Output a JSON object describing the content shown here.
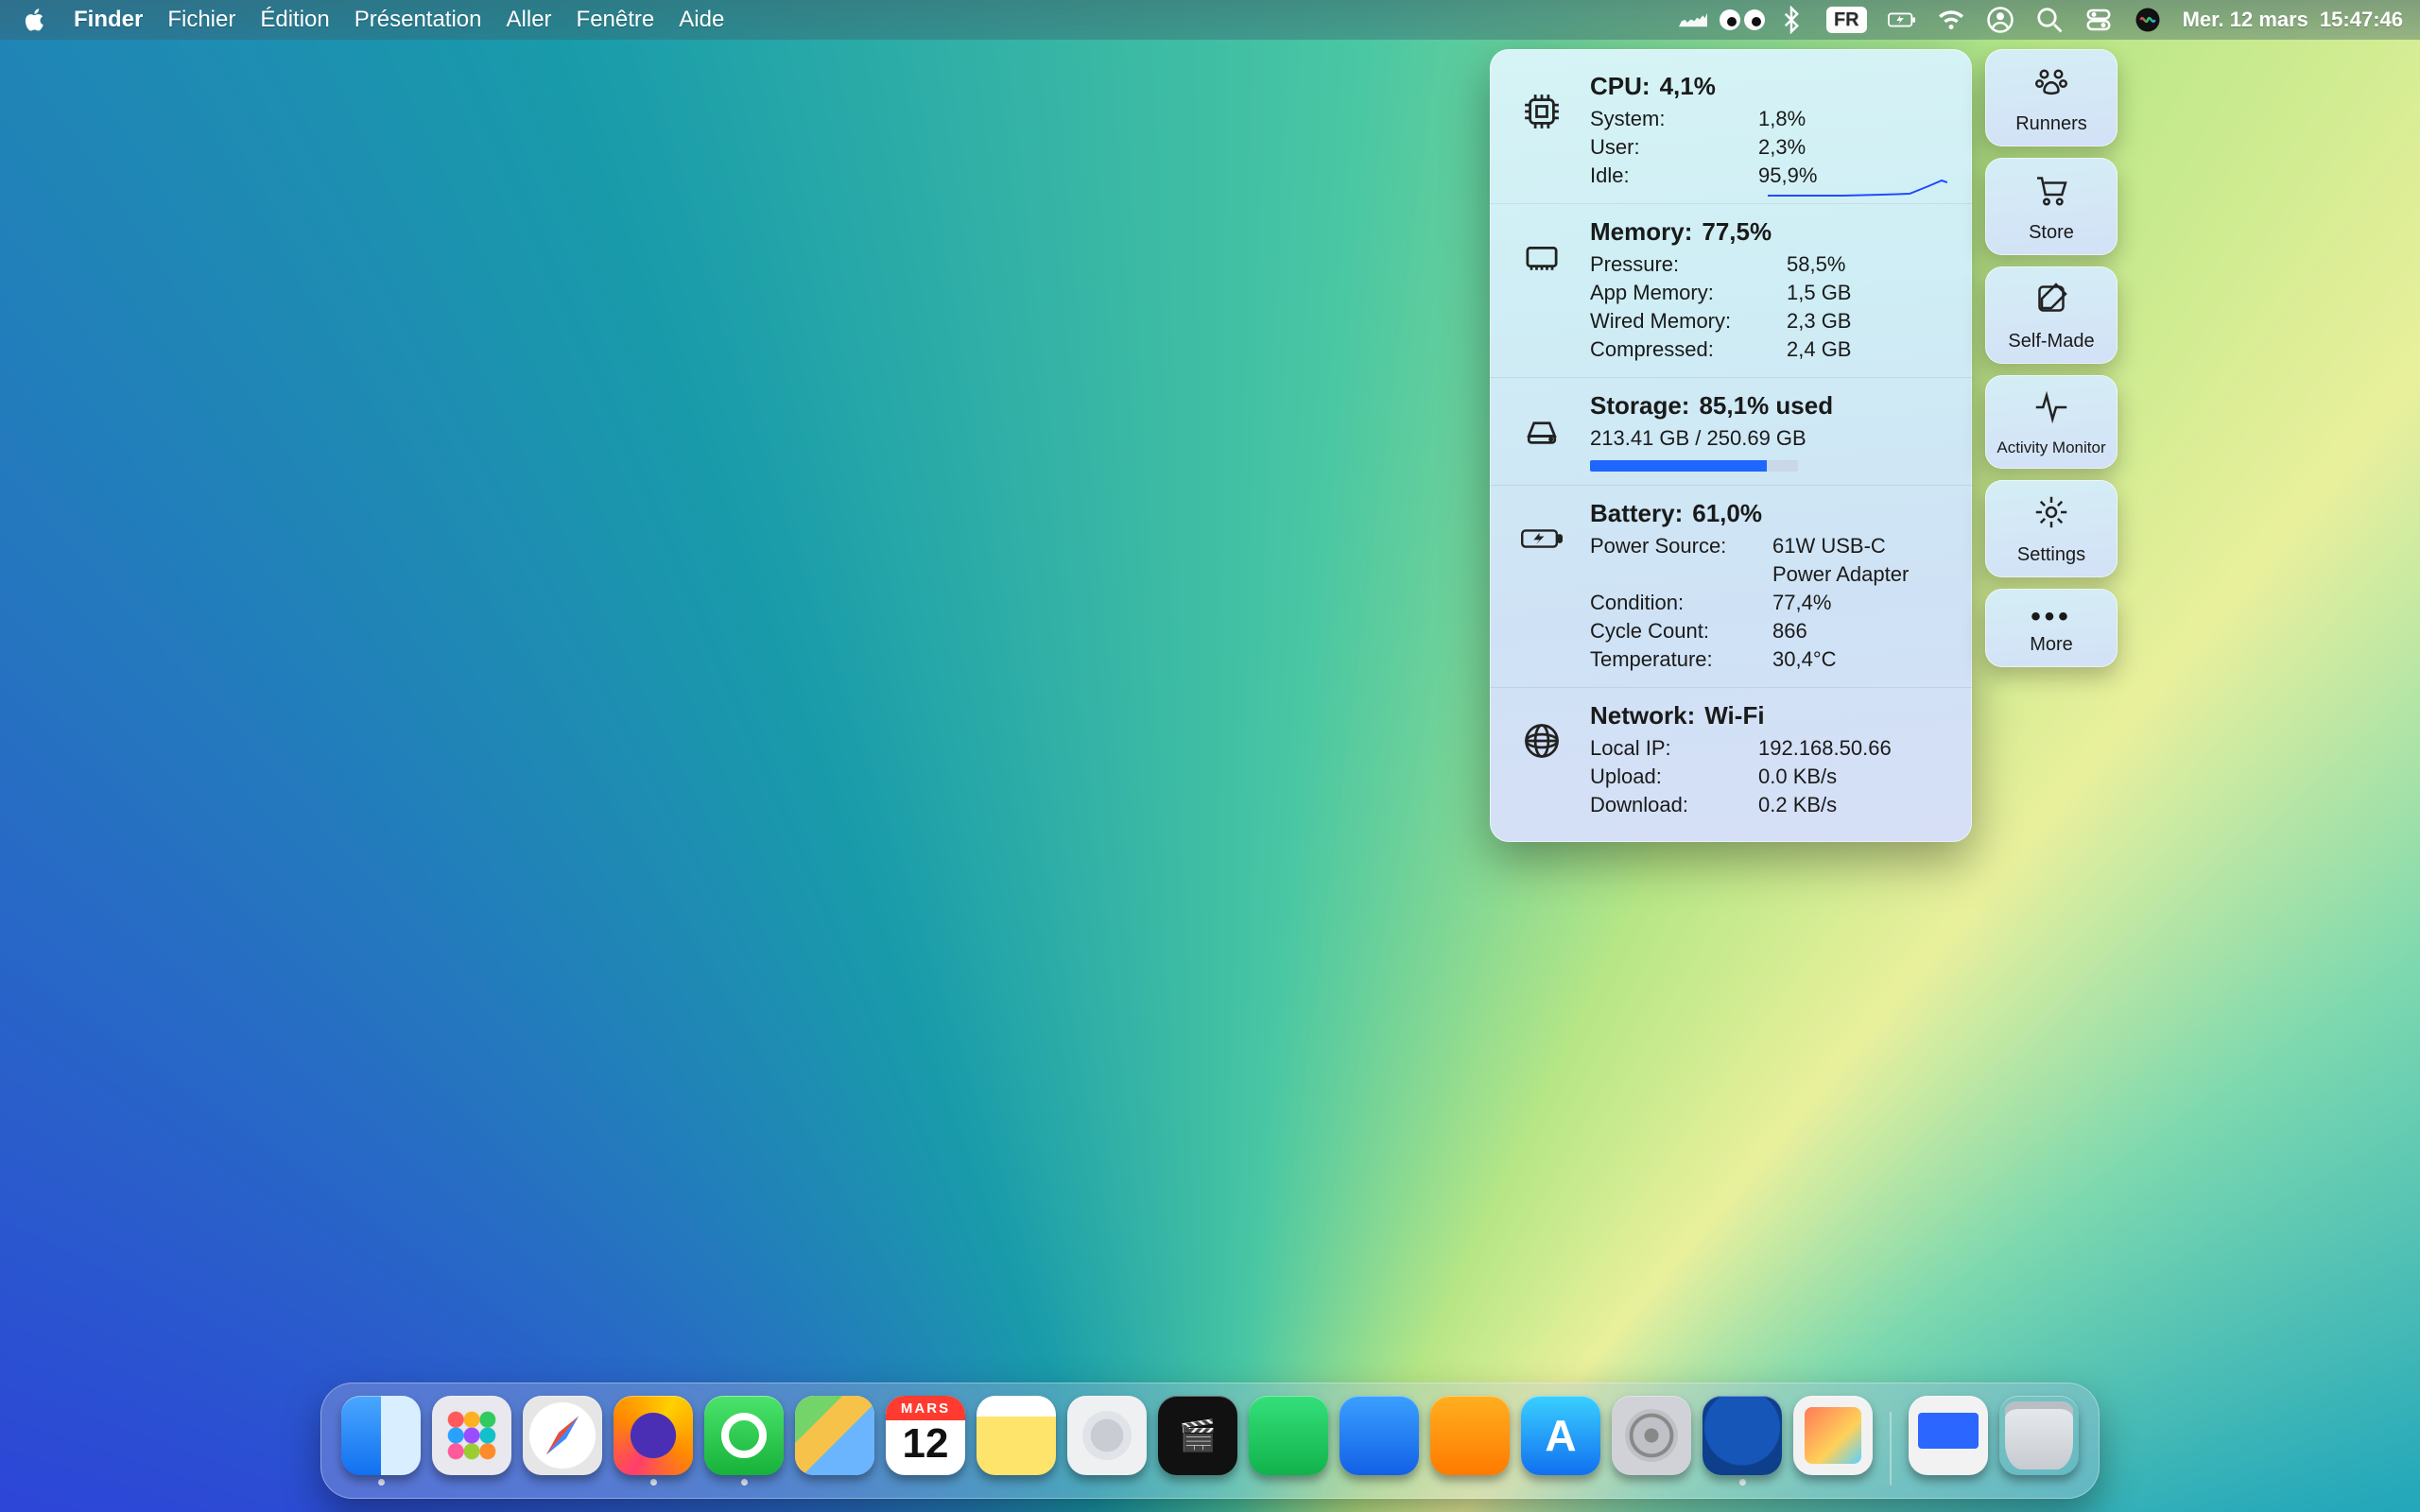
{
  "menubar": {
    "app_name": "Finder",
    "menus": [
      "Fichier",
      "Édition",
      "Présentation",
      "Aller",
      "Fenêtre",
      "Aide"
    ],
    "input_badge": "FR",
    "date": "Mer. 12 mars",
    "time": "15:47:46"
  },
  "runcat_panel": {
    "cpu": {
      "title_label": "CPU:",
      "title_value": "4,1%",
      "rows": [
        {
          "k": "System:",
          "v": "1,8%"
        },
        {
          "k": "User:",
          "v": "2,3%"
        },
        {
          "k": "Idle:",
          "v": "95,9%"
        }
      ]
    },
    "memory": {
      "title_label": "Memory:",
      "title_value": "77,5%",
      "rows": [
        {
          "k": "Pressure:",
          "v": "58,5%"
        },
        {
          "k": "App Memory:",
          "v": "1,5 GB"
        },
        {
          "k": "Wired Memory:",
          "v": "2,3 GB"
        },
        {
          "k": "Compressed:",
          "v": "2,4 GB"
        }
      ]
    },
    "storage": {
      "title_label": "Storage:",
      "title_value": "85,1% used",
      "detail": "213.41 GB / 250.69 GB",
      "fill_percent": 85.1
    },
    "battery": {
      "title_label": "Battery:",
      "title_value": "61,0%",
      "rows": [
        {
          "k": "Power Source:",
          "v": "61W USB-C Power Adapter"
        },
        {
          "k": "Condition:",
          "v": "77,4%"
        },
        {
          "k": "Cycle Count:",
          "v": "866"
        },
        {
          "k": "Temperature:",
          "v": "30,4°C"
        }
      ]
    },
    "network": {
      "title_label": "Network:",
      "title_value": "Wi-Fi",
      "rows": [
        {
          "k": "Local IP:",
          "v": "192.168.50.66"
        },
        {
          "k": "Upload:",
          "v": "0.0 KB/s"
        },
        {
          "k": "Download:",
          "v": "0.2 KB/s"
        }
      ]
    },
    "side_buttons": {
      "runners": "Runners",
      "store": "Store",
      "self_made": "Self-Made",
      "activity_monitor": "Activity Monitor",
      "settings": "Settings",
      "more": "More"
    }
  },
  "dock": {
    "calendar_month": "MARS",
    "calendar_day": "12",
    "items": [
      {
        "name": "finder",
        "running": true
      },
      {
        "name": "launchpad",
        "running": false
      },
      {
        "name": "safari",
        "running": false
      },
      {
        "name": "firefox",
        "running": true
      },
      {
        "name": "whatsapp",
        "running": true
      },
      {
        "name": "maps",
        "running": false
      },
      {
        "name": "calendar",
        "running": false
      },
      {
        "name": "notes",
        "running": false
      },
      {
        "name": "passwords",
        "running": false
      },
      {
        "name": "tv",
        "running": false
      },
      {
        "name": "numbers",
        "running": false
      },
      {
        "name": "keynote",
        "running": false
      },
      {
        "name": "pages",
        "running": false
      },
      {
        "name": "appstore",
        "running": false
      },
      {
        "name": "system-settings",
        "running": false
      },
      {
        "name": "thunderbird",
        "running": true
      },
      {
        "name": "preview",
        "running": false
      }
    ]
  }
}
